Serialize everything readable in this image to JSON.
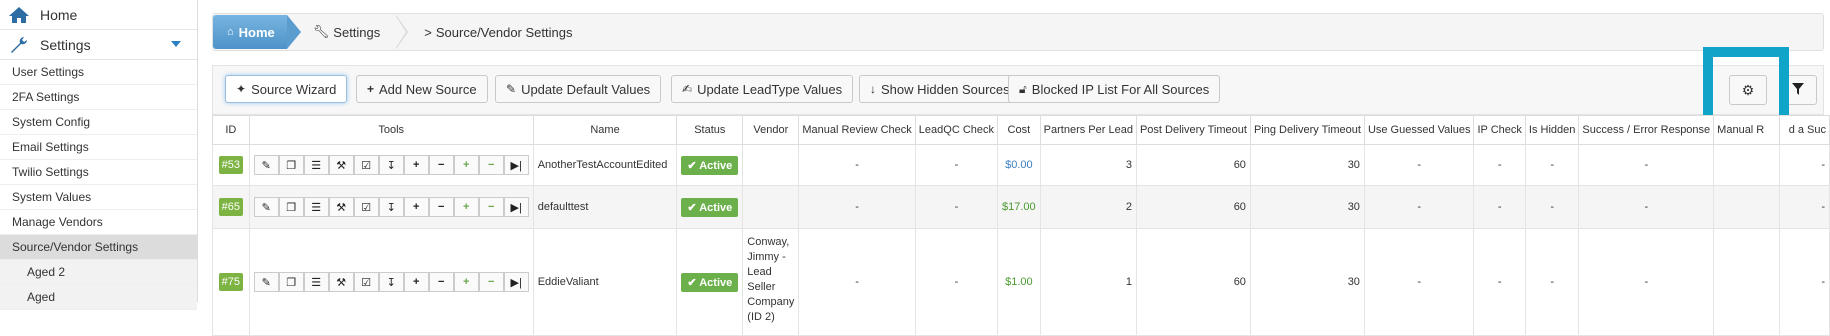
{
  "sidebar": {
    "home": "Home",
    "settings": "Settings",
    "items": [
      {
        "label": "User Settings"
      },
      {
        "label": "2FA Settings"
      },
      {
        "label": "System Config"
      },
      {
        "label": "Email Settings"
      },
      {
        "label": "Twilio Settings"
      },
      {
        "label": "System Values"
      },
      {
        "label": "Manage Vendors"
      },
      {
        "label": "Source/Vendor Settings"
      }
    ],
    "children": [
      {
        "label": "Aged 2"
      },
      {
        "label": "Aged"
      }
    ]
  },
  "breadcrumb": {
    "home": "Home",
    "settings": "Settings",
    "current": "Source/Vendor Settings"
  },
  "toolbar": {
    "source_wizard": "Source Wizard",
    "add_new_source": "Add New Source",
    "update_default_values": "Update Default Values",
    "update_leadtype_values": "Update LeadType Values",
    "show_hidden_sources": "Show Hidden Sources",
    "blocked_ip_list": "Blocked IP List For All Sources"
  },
  "table": {
    "headers": {
      "id": "ID",
      "tools": "Tools",
      "name": "Name",
      "status": "Status",
      "vendor": "Vendor",
      "manual_review_check": "Manual Review Check",
      "leadqc_check": "LeadQC Check",
      "cost": "Cost",
      "partners_per_lead": "Partners Per Lead",
      "post_delivery_timeout": "Post Delivery Timeout",
      "ping_delivery_timeout": "Ping Delivery Timeout",
      "use_guessed_values": "Use Guessed Values",
      "ip_check": "IP Check",
      "is_hidden": "Is Hidden",
      "success_error_response": "Success / Error Response",
      "manual_r": "Manual R",
      "last_col": "d a Suc"
    },
    "rows": [
      {
        "id": "#53",
        "name": "AnotherTestAccountEdited",
        "status": "Active",
        "vendor": "",
        "manual_review_check": "-",
        "leadqc_check": "-",
        "cost": "$0.00",
        "partners_per_lead": "3",
        "post_delivery_timeout": "60",
        "ping_delivery_timeout": "30",
        "use_guessed_values": "-",
        "ip_check": "-",
        "is_hidden": "-",
        "success_error_response": "-",
        "last": "-"
      },
      {
        "id": "#65",
        "name": "defaulttest",
        "status": "Active",
        "vendor": "",
        "manual_review_check": "-",
        "leadqc_check": "-",
        "cost": "$17.00",
        "partners_per_lead": "2",
        "post_delivery_timeout": "60",
        "ping_delivery_timeout": "30",
        "use_guessed_values": "-",
        "ip_check": "-",
        "is_hidden": "-",
        "success_error_response": "-",
        "last": "-"
      },
      {
        "id": "#75",
        "name": "EddieValiant",
        "status": "Active",
        "vendor": "Conway, Jimmy - Lead Seller Company (ID 2)",
        "manual_review_check": "-",
        "leadqc_check": "-",
        "cost": "$1.00",
        "partners_per_lead": "1",
        "post_delivery_timeout": "60",
        "ping_delivery_timeout": "30",
        "use_guessed_values": "-",
        "ip_check": "-",
        "is_hidden": "-",
        "success_error_response": "-",
        "last": "-"
      }
    ]
  },
  "icons": {
    "tools": [
      "pencil-icon",
      "copy-icon",
      "list-icon",
      "gavel-icon",
      "check-square-icon",
      "download-circle-icon",
      "plus-icon",
      "minus-icon",
      "plus-green-icon",
      "minus-green-icon",
      "step-forward-icon"
    ]
  },
  "colors": {
    "active_green": "#6bb04a",
    "id_green": "#7cb342",
    "home_blue": "#4d93c9",
    "highlight": "#10a5c8",
    "cost_blue": "#3a7fc1",
    "cost_green": "#4a9a2f"
  }
}
